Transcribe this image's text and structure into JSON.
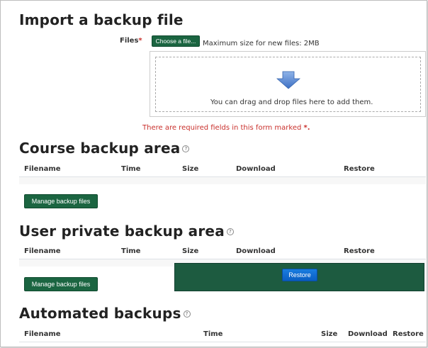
{
  "import": {
    "heading": "Import a backup file",
    "files_label": "Files",
    "required_mark": "*",
    "choose_button": "Choose a file...",
    "max_size": "Maximum size for new files: 2MB",
    "drop_hint": "You can drag and drop files here to add them.",
    "required_notice": "There are required fields in this form marked",
    "required_notice_mark": "*."
  },
  "course_area": {
    "heading": "Course backup area",
    "columns": [
      "Filename",
      "Time",
      "Size",
      "Download",
      "Restore"
    ],
    "manage_button": "Manage backup files"
  },
  "user_area": {
    "heading": "User private backup area",
    "columns": [
      "Filename",
      "Time",
      "Size",
      "Download",
      "Restore"
    ],
    "manage_button": "Manage backup files",
    "restore_button": "Restore"
  },
  "automated": {
    "heading": "Automated backups",
    "columns": [
      "Filename",
      "Time",
      "Size",
      "Download",
      "Restore"
    ]
  },
  "colors": {
    "button_green": "#1b6541",
    "panel_green": "#1d5b40",
    "button_blue": "#0a6fd6",
    "required_red": "#c9302c",
    "drop_arrow": "#4a7fcb"
  },
  "icons": {
    "help": "question-circle-icon",
    "drop_arrow": "arrow-down-icon"
  }
}
